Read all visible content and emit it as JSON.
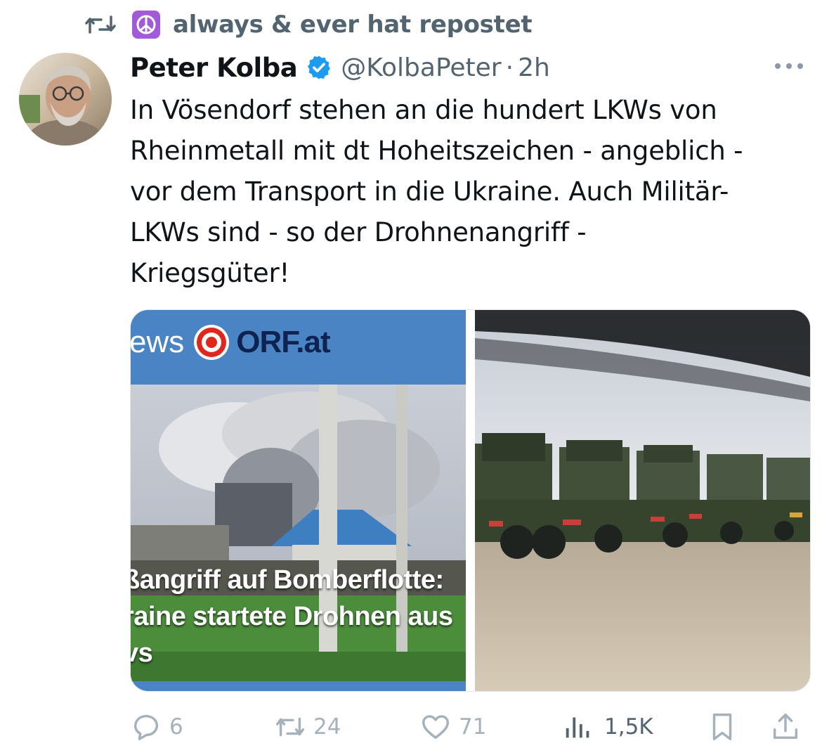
{
  "social_context": {
    "icon": "repost-icon",
    "badge_icon": "peace-symbol-icon",
    "text": "always & ever hat repostet"
  },
  "author": {
    "name": "Peter Kolba",
    "verified": true,
    "handle": "@KolbaPeter",
    "separator": "·",
    "time": "2h"
  },
  "tweet": {
    "lines": [
      "In Vösendorf stehen an die hundert LKWs von",
      "Rheinmetall mit dt Hoheitszeichen - angeblich -",
      "vor dem Transport in die Ukraine. Auch Militär-",
      "LKWs sind - so der Drohnenangriff -",
      "Kriegsgüter!"
    ]
  },
  "media": {
    "left": {
      "brand_left": "ews",
      "brand_right": "ORF.at",
      "caption_lines": [
        "ßangriff auf Bomberflotte:",
        "raine startete Drohnen aus",
        "vs"
      ]
    },
    "right": {
      "description_icon": "military-trucks-photo"
    }
  },
  "actions": {
    "replies": "6",
    "reposts": "24",
    "likes": "71",
    "views": "1,5K"
  },
  "colors": {
    "accent": "#1d9bf0",
    "secondary_text": "#536471",
    "orf_blue": "#4a84c5",
    "peace_badge": "#a35ad9"
  }
}
